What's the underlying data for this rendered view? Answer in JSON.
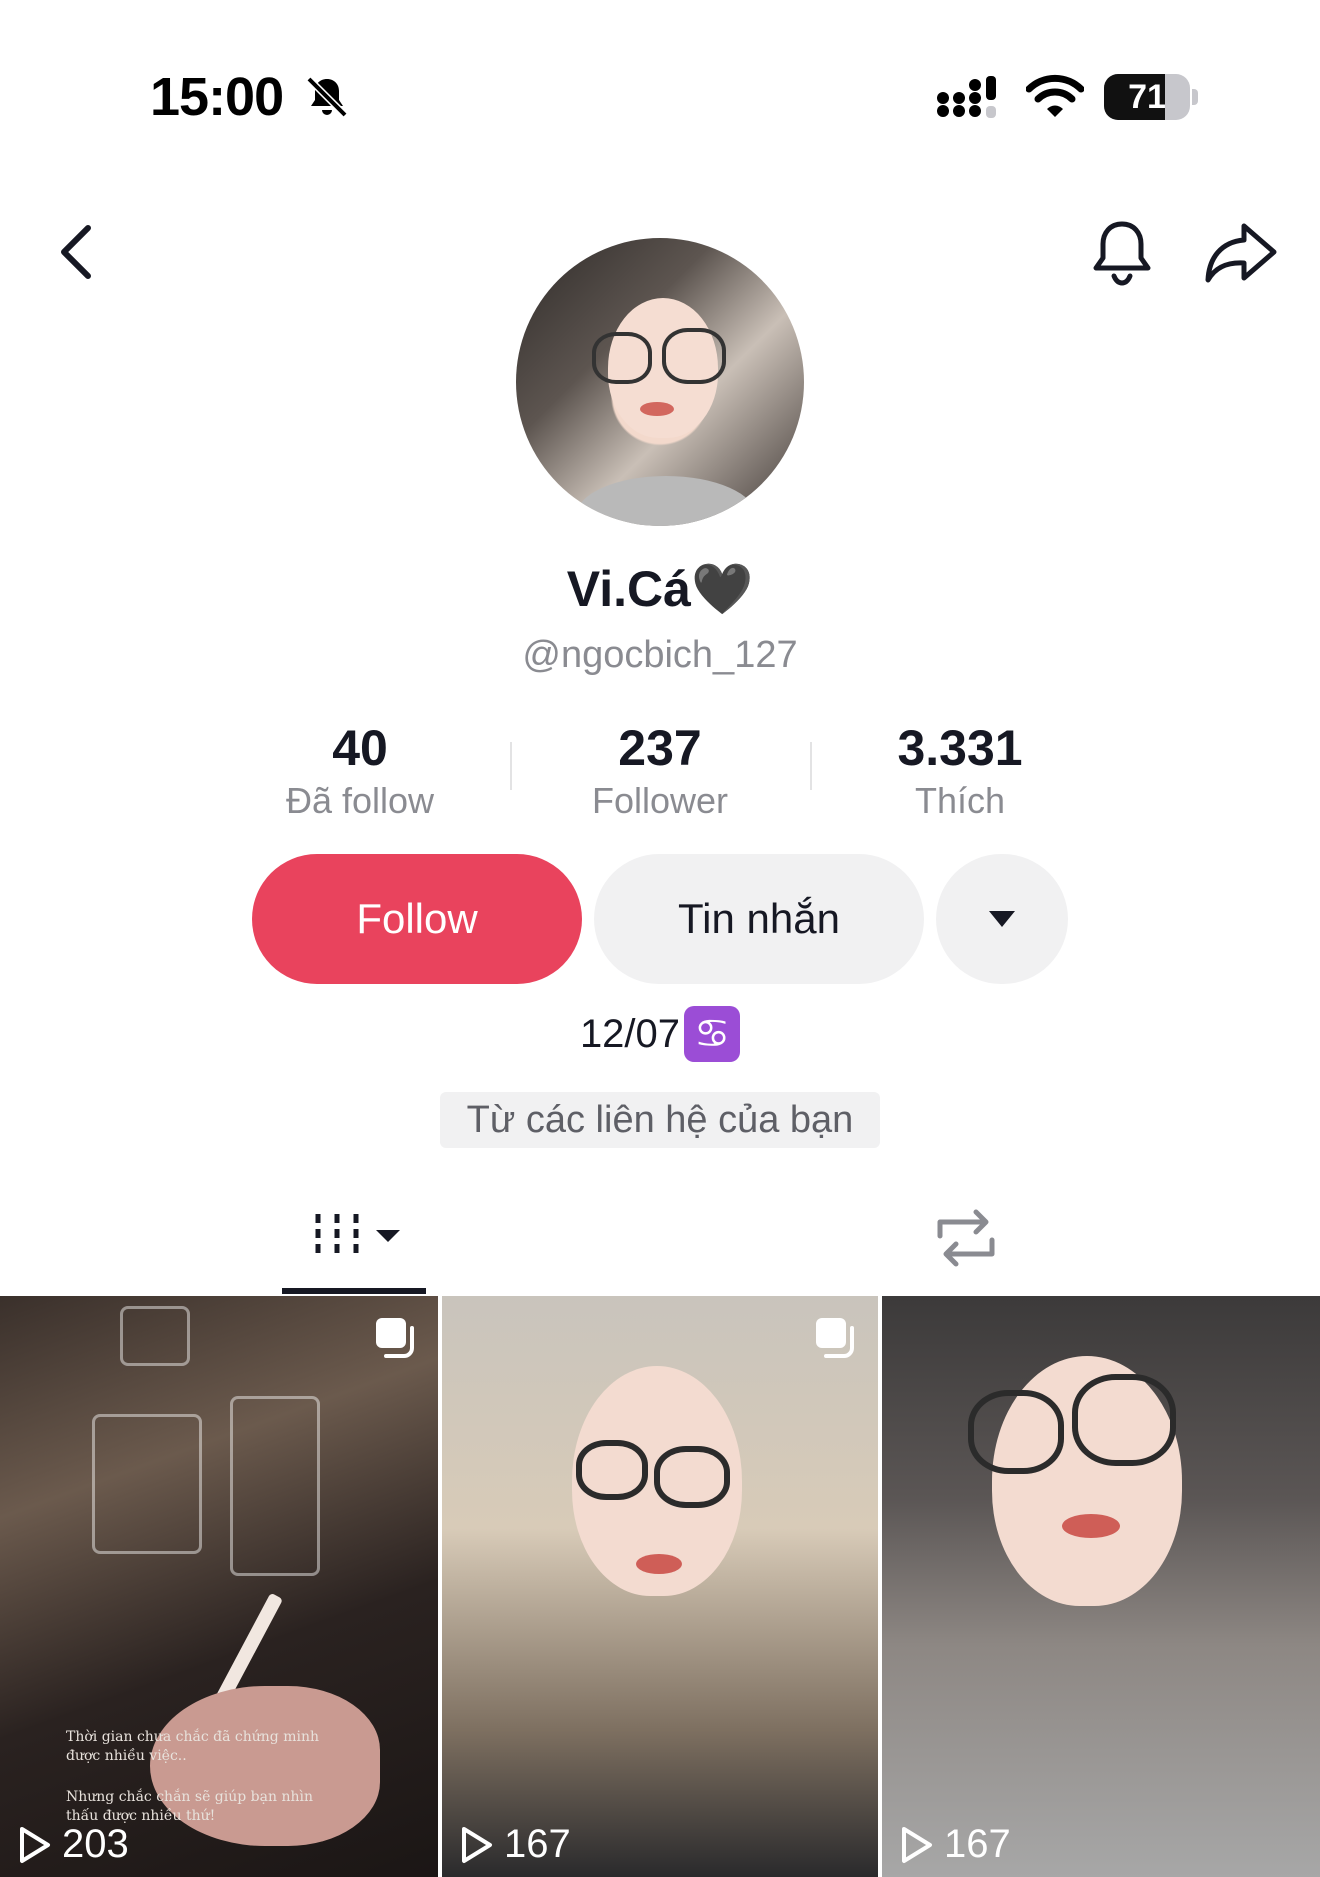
{
  "status_bar": {
    "time": "15:00",
    "battery": "71",
    "battery_fraction": 0.71
  },
  "profile": {
    "display_name": "Vi.Cá🖤",
    "username": "@ngocbich_127",
    "bio_date": "12/07",
    "bio_emoji": "♋",
    "contact_note": "Từ các liên hệ của bạn"
  },
  "stats": [
    {
      "value": "40",
      "label": "Đã follow"
    },
    {
      "value": "237",
      "label": "Follower"
    },
    {
      "value": "3.331",
      "label": "Thích"
    }
  ],
  "actions": {
    "follow": "Follow",
    "message": "Tin nhắn"
  },
  "videos": [
    {
      "views": "203",
      "caption_1": "Thời gian chưa chắc đã chứng minh được nhiều việc..",
      "caption_2": "Nhưng chắc chắn sẽ giúp bạn nhìn thấu được nhiều thứ!"
    },
    {
      "views": "167"
    },
    {
      "views": "167"
    }
  ],
  "colors": {
    "accent": "#e9435d",
    "text": "#161823",
    "muted": "#8a8b91",
    "pill": "#f1f1f2"
  },
  "icons": [
    "bell-off-icon",
    "signal-icon",
    "wifi-icon",
    "battery-icon",
    "back-icon",
    "notification-bell-icon",
    "share-icon",
    "video-grid-icon",
    "repost-icon",
    "multi-photo-icon",
    "play-icon"
  ]
}
